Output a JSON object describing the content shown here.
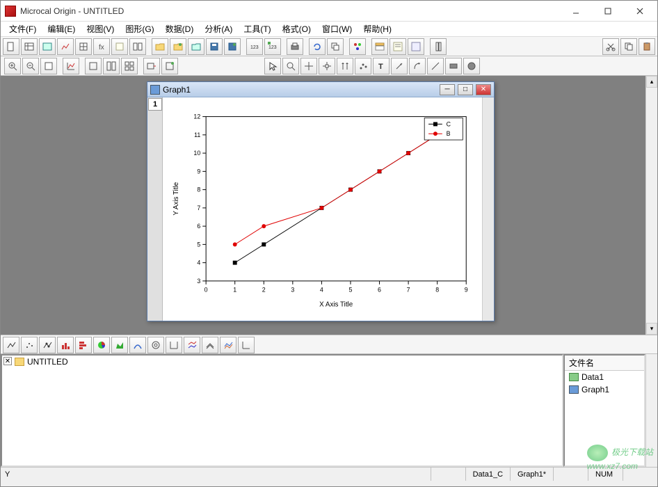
{
  "window": {
    "title": "Microcal Origin - UNTITLED"
  },
  "menu": [
    "文件(F)",
    "编辑(E)",
    "视图(V)",
    "图形(G)",
    "数据(D)",
    "分析(A)",
    "工具(T)",
    "格式(O)",
    "窗口(W)",
    "帮助(H)"
  ],
  "graph_window": {
    "title": "Graph1",
    "tab_label": "1"
  },
  "chart_data": {
    "type": "line",
    "xlabel": "X Axis Title",
    "ylabel": "Y Axis Title",
    "xlim": [
      0,
      9
    ],
    "ylim": [
      3,
      12
    ],
    "xticks": [
      0,
      1,
      2,
      3,
      4,
      5,
      6,
      7,
      8,
      9
    ],
    "yticks": [
      3,
      4,
      5,
      6,
      7,
      8,
      9,
      10,
      11,
      12
    ],
    "legend_pos": "top-right",
    "series": [
      {
        "name": "C",
        "color": "#000000",
        "marker": "square",
        "x": [
          1,
          2,
          4,
          5,
          6,
          7,
          8
        ],
        "y": [
          4,
          5,
          7,
          8,
          9,
          10,
          11
        ]
      },
      {
        "name": "B",
        "color": "#e00000",
        "marker": "circle",
        "x": [
          1,
          2,
          4,
          5,
          6,
          7,
          8
        ],
        "y": [
          5,
          6,
          7,
          8,
          9,
          10,
          11
        ]
      }
    ]
  },
  "project": {
    "root": "UNTITLED",
    "files_header": "文件名",
    "files": [
      "Data1",
      "Graph1"
    ]
  },
  "status": {
    "left": "Y",
    "cells": [
      "",
      "Data1_C",
      "Graph1*",
      "",
      "NUM",
      ""
    ]
  },
  "watermark": {
    "line1": "极光下载站",
    "line2": "www.xz7.com"
  }
}
